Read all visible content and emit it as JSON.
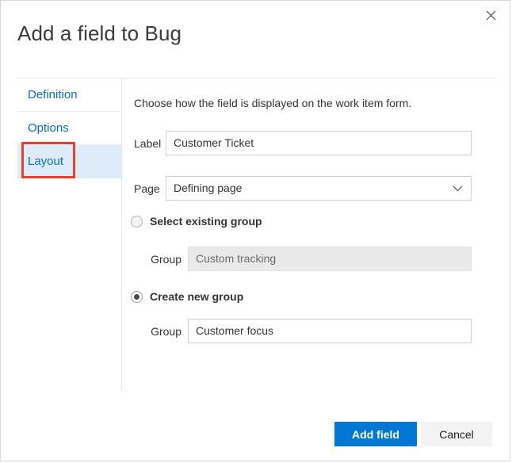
{
  "dialog": {
    "title": "Add a field to Bug",
    "close_icon": "close-icon"
  },
  "sidebar": {
    "items": [
      {
        "label": "Definition",
        "selected": false
      },
      {
        "label": "Options",
        "selected": false
      },
      {
        "label": "Layout",
        "selected": true
      }
    ]
  },
  "main": {
    "description": "Choose how the field is displayed on the work item form.",
    "fields": {
      "label": {
        "label": "Label",
        "value": "Customer Ticket"
      },
      "page": {
        "label": "Page",
        "value": "Defining page",
        "chevron_icon": "chevron-down-icon"
      }
    },
    "group_options": [
      {
        "radio_label": "Select existing group",
        "selected": false,
        "field_label": "Group",
        "field_value": "Custom tracking",
        "disabled": true
      },
      {
        "radio_label": "Create new group",
        "selected": true,
        "field_label": "Group",
        "field_value": "Customer focus",
        "disabled": false
      }
    ]
  },
  "footer": {
    "primary_button": "Add field",
    "secondary_button": "Cancel"
  },
  "colors": {
    "accent": "#0078d4",
    "link": "#0a6cc4",
    "selected_nav_bg": "#deecf9",
    "highlight_box": "#e8402a",
    "disabled_field_bg": "#e9e9e9"
  }
}
